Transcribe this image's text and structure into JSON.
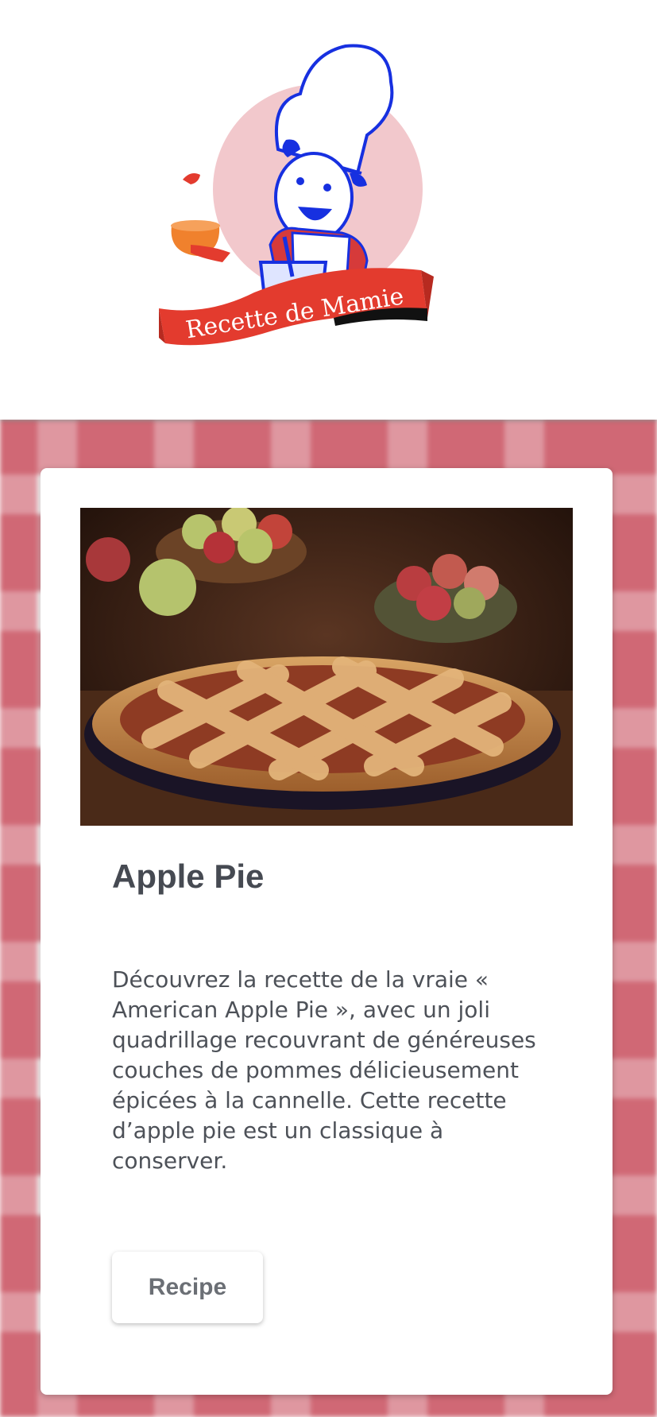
{
  "header": {
    "logo_text": "Recette de Mamie",
    "colors": {
      "ribbon": "#e33b2e",
      "chef_blue": "#1730e0",
      "circle": "#f2c8cc"
    }
  },
  "background": {
    "pattern": "gingham",
    "color": "#c44252"
  },
  "card": {
    "image_icon": "apple-pie-photo",
    "title": "Apple Pie",
    "description": "Découvrez la recette de la vraie « American Apple Pie », avec un joli quadrillage recouvrant de généreuses couches de pommes délicieusement épicées à la cannelle. Cette recette d’apple pie est un classique à conserver.",
    "button_label": "Recipe"
  }
}
